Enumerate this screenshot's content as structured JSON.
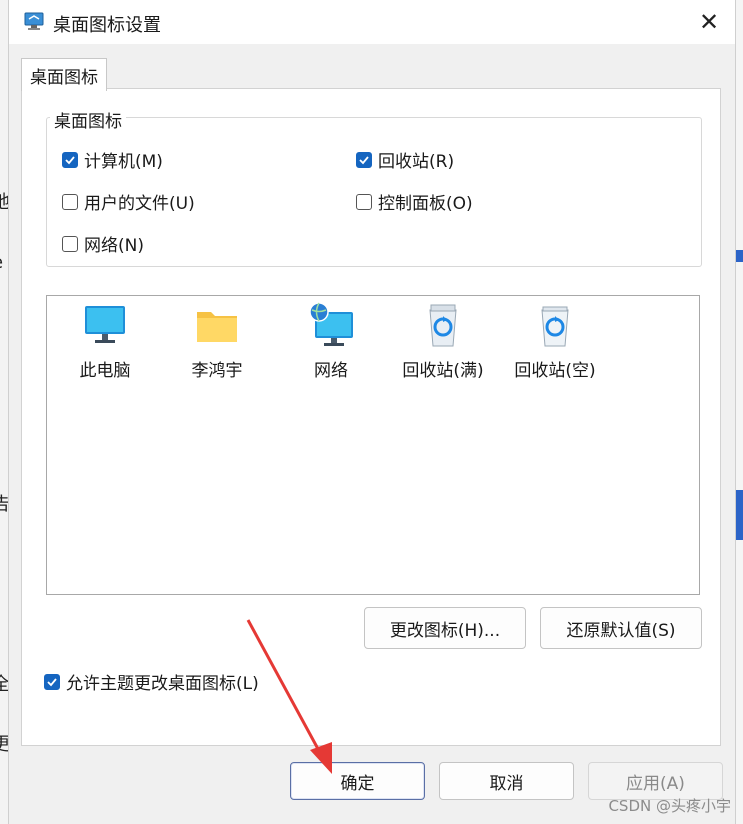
{
  "window": {
    "title": "桌面图标设置",
    "close_glyph": "✕"
  },
  "tab": {
    "label": "桌面图标"
  },
  "group": {
    "label": "桌面图标",
    "checkboxes": [
      {
        "label": "计算机(M)",
        "checked": true
      },
      {
        "label": "回收站(R)",
        "checked": true
      },
      {
        "label": "用户的文件(U)",
        "checked": false
      },
      {
        "label": "控制面板(O)",
        "checked": false
      },
      {
        "label": "网络(N)",
        "checked": false
      }
    ]
  },
  "icons": [
    {
      "label": "此电脑",
      "icon": "monitor-icon"
    },
    {
      "label": "李鸿宇",
      "icon": "folder-icon"
    },
    {
      "label": "网络",
      "icon": "network-icon"
    },
    {
      "label": "回收站(满)",
      "icon": "recycle-bin-full-icon"
    },
    {
      "label": "回收站(空)",
      "icon": "recycle-bin-empty-icon"
    }
  ],
  "buttons": {
    "change_icon": "更改图标(H)...",
    "restore_default": "还原默认值(S)",
    "ok": "确定",
    "cancel": "取消",
    "apply": "应用(A)"
  },
  "allow_theme": {
    "label": "允许主题更改桌面图标(L)",
    "checked": true
  },
  "background_chars": [
    "地",
    "e",
    "告",
    "全",
    "更"
  ],
  "watermark": "CSDN @头疼小宇",
  "colors": {
    "accent": "#1565c0",
    "arrow": "#e53935"
  }
}
